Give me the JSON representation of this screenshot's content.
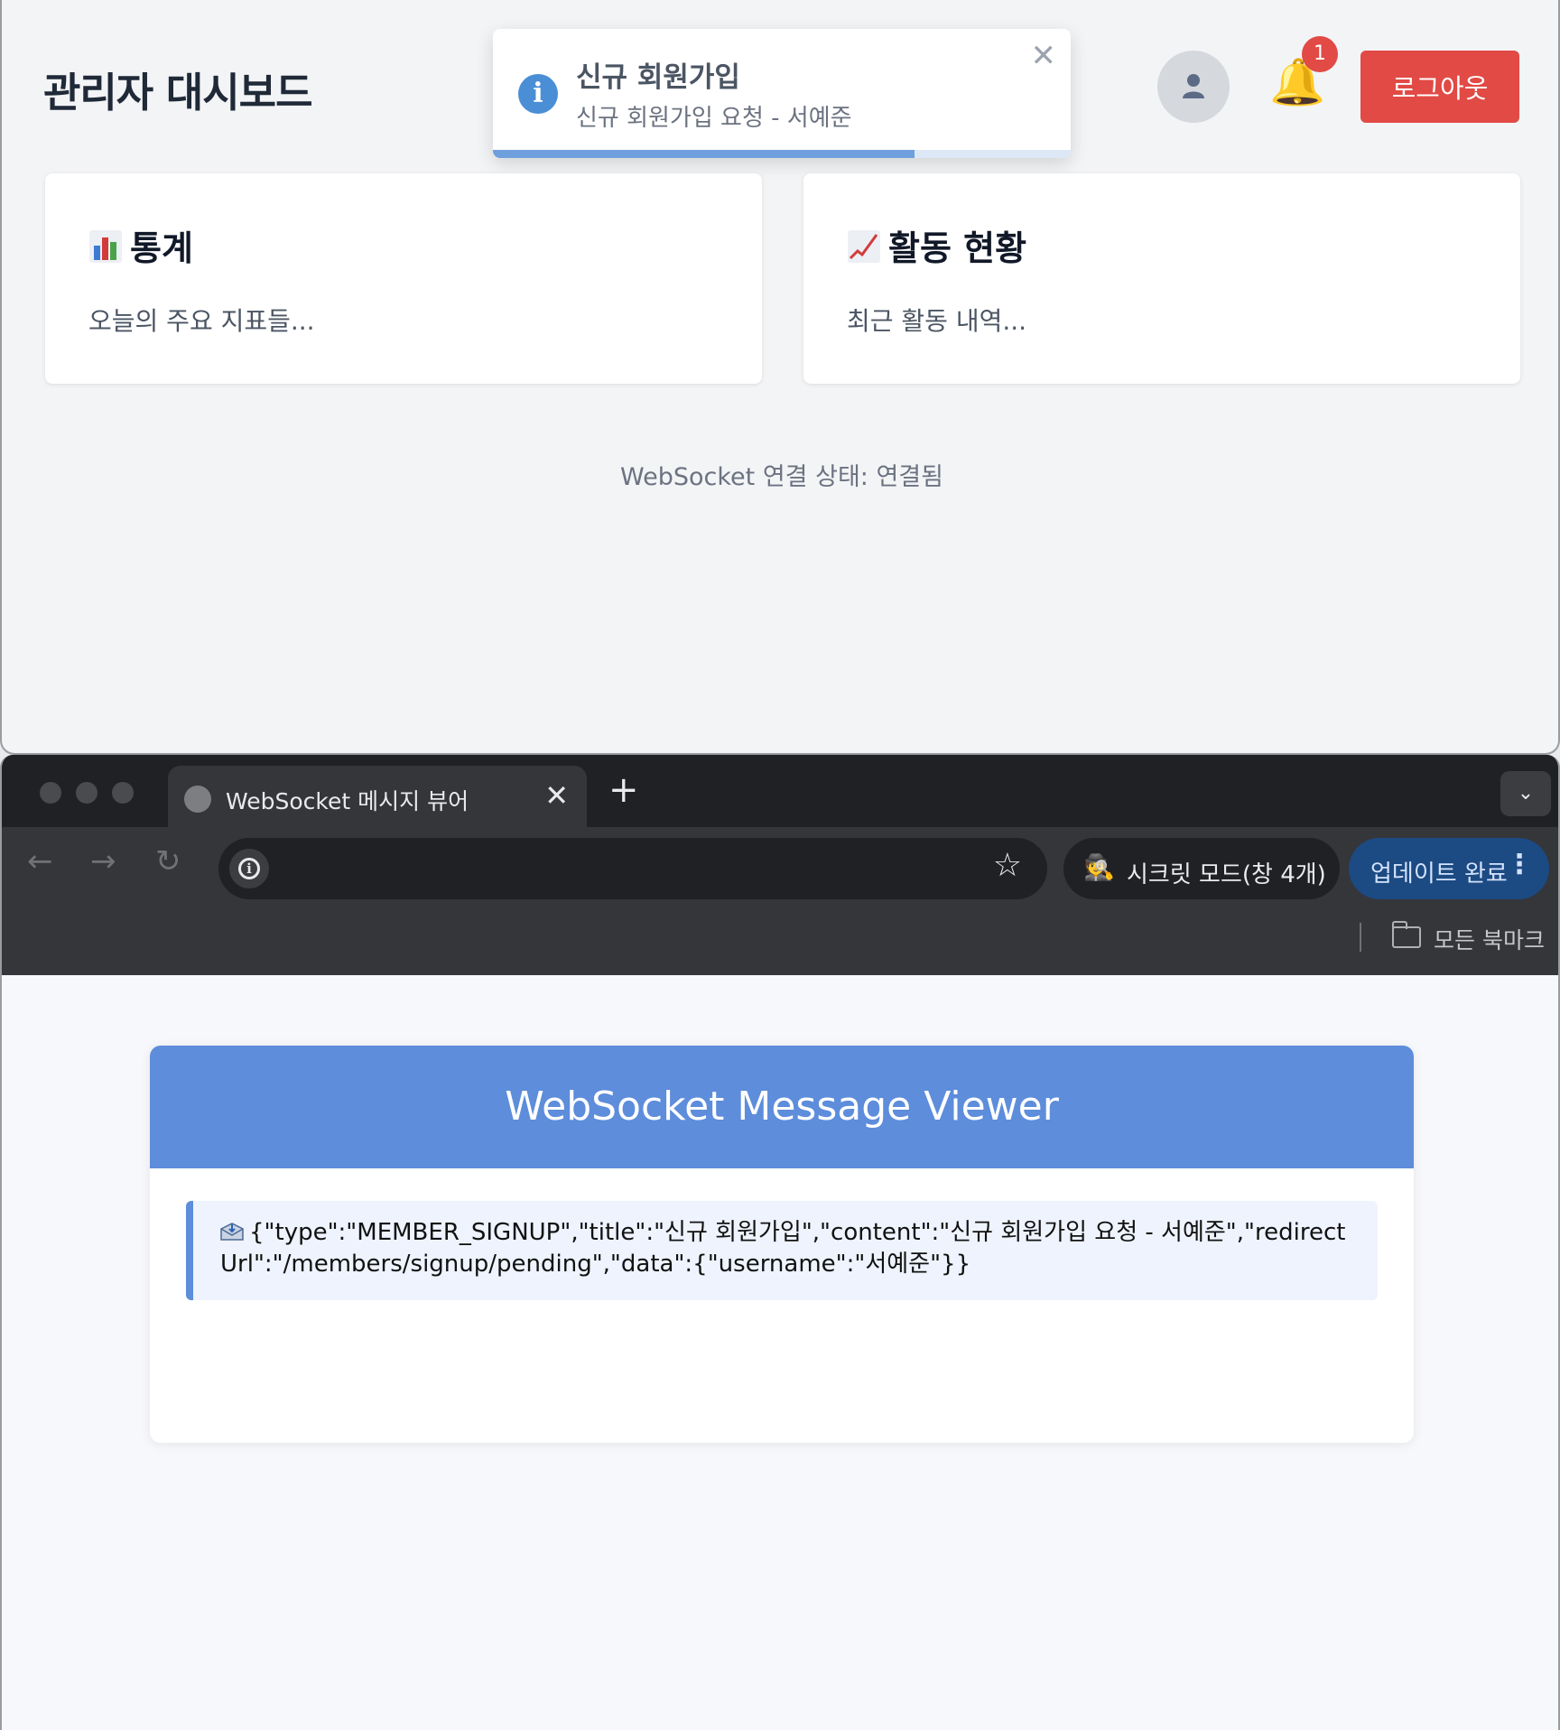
{
  "dashboard": {
    "title": "관리자 대시보드",
    "toast": {
      "icon": "info-icon",
      "title": "신규 회원가입",
      "message": "신규 회원가입 요청 - 서예준",
      "close": "✕",
      "progress": 0.73
    },
    "notifications": {
      "icon": "bell-icon",
      "badge": "1"
    },
    "avatar_icon": "user-icon",
    "logout_label": "로그아웃",
    "cards": [
      {
        "icon": "bar-chart-emoji",
        "title": "통계",
        "text": "오늘의 주요 지표들..."
      },
      {
        "icon": "trend-chart-emoji",
        "title": "활동 현황",
        "text": "최근 활동 내역..."
      }
    ],
    "ws_status": "WebSocket 연결 상태: 연결됨"
  },
  "browser": {
    "tab": {
      "title": "WebSocket 메시지 뷰어",
      "icon": "globe-icon",
      "close": "✕"
    },
    "new_tab": "+",
    "tab_menu": "⌄",
    "nav": {
      "back": "←",
      "forward": "→",
      "reload": "↻"
    },
    "star": "☆",
    "incognito": {
      "glyph": "🕵",
      "label": "시크릿 모드(창 4개)"
    },
    "update": {
      "label": "업데이트 완료",
      "dots": "⋮"
    },
    "bookmarks_label": "모든 북마크",
    "colors": {
      "frame": "#202124",
      "toolbar": "#35363a",
      "update_bg": "#1c4a82"
    }
  },
  "viewer": {
    "title": "WebSocket Message Viewer",
    "message_icon": "incoming-envelope-icon",
    "messages": [
      "{\"type\":\"MEMBER_SIGNUP\",\"title\":\"신규 회원가입\",\"content\":\"신규 회원가입 요청 - 서예준\",\"redirectUrl\":\"/members/signup/pending\",\"data\":{\"username\":\"서예준\"}}"
    ],
    "colors": {
      "header": "#5d8ddb",
      "message_bg": "#eef3fd"
    }
  },
  "colors": {
    "danger": "#e14a45",
    "info": "#4a8fd6",
    "page_bg": "#f3f4f6"
  }
}
